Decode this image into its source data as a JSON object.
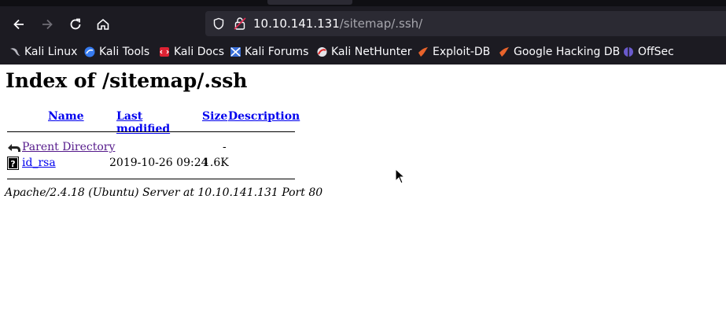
{
  "browser": {
    "url_host": "10.10.141.131",
    "url_path": "/sitemap/.ssh/",
    "bookmarks": [
      {
        "label": "Kali Linux",
        "icon": "kali-dragon-icon"
      },
      {
        "label": "Kali Tools",
        "icon": "kali-tools-icon"
      },
      {
        "label": "Kali Docs",
        "icon": "kali-docs-icon"
      },
      {
        "label": "Kali Forums",
        "icon": "kali-forums-icon"
      },
      {
        "label": "Kali NetHunter",
        "icon": "nethunter-icon"
      },
      {
        "label": "Exploit-DB",
        "icon": "exploit-db-icon"
      },
      {
        "label": "Google Hacking DB",
        "icon": "ghdb-icon"
      },
      {
        "label": "OffSec",
        "icon": "offsec-icon"
      }
    ]
  },
  "page": {
    "title": "Index of /sitemap/.ssh",
    "headers": {
      "name": "Name",
      "last_modified": "Last modified",
      "size": "Size",
      "description": "Description"
    },
    "rows": [
      {
        "name": "Parent Directory",
        "modified": "",
        "size": "-",
        "icon": "back-folder-icon"
      },
      {
        "name": "id_rsa",
        "modified": "2019-10-26 09:24",
        "size": "1.6K",
        "icon": "unknown-file-icon"
      }
    ],
    "footer": "Apache/2.4.18 (Ubuntu) Server at 10.10.141.131 Port 80"
  },
  "colors": {
    "chrome_bg": "#1c1b22",
    "urlbar_bg": "#2b2a33",
    "link": "#0000ee",
    "visited": "#551a8b"
  }
}
